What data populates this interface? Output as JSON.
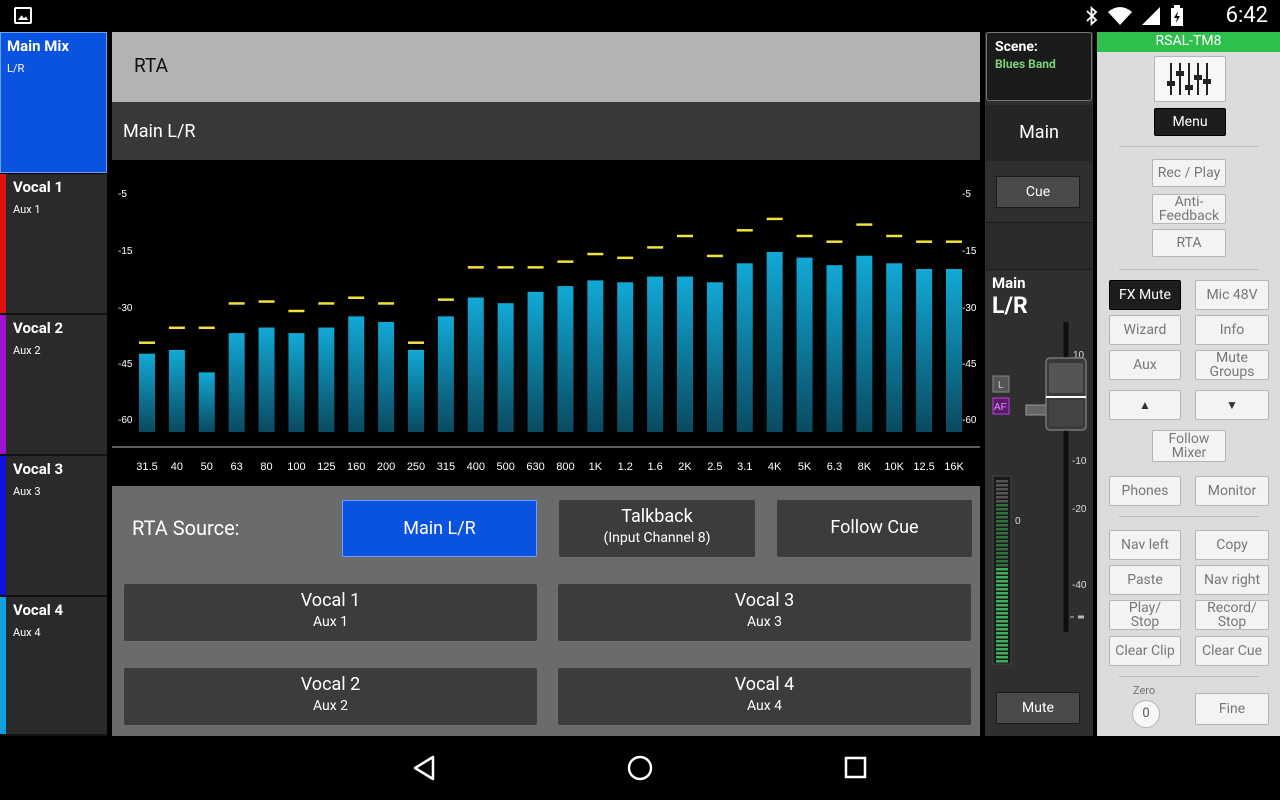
{
  "status_bar": {
    "time": "6:42",
    "icons": [
      "image-icon",
      "bluetooth-icon",
      "wifi-icon",
      "signal-icon",
      "battery-icon"
    ]
  },
  "sidebar": {
    "items": [
      {
        "title": "Main Mix",
        "sub": "L/R",
        "active": true,
        "color": "#0a52e0"
      },
      {
        "title": "Vocal 1",
        "sub": "Aux 1",
        "color": "#e01010"
      },
      {
        "title": "Vocal 2",
        "sub": "Aux 2",
        "color": "#a010d0"
      },
      {
        "title": "Vocal 3",
        "sub": "Aux 3",
        "color": "#1010e0"
      },
      {
        "title": "Vocal 4",
        "sub": "Aux 4",
        "color": "#10a0e0"
      }
    ]
  },
  "main": {
    "header": "RTA",
    "subheader": "Main L/R"
  },
  "chart_data": {
    "type": "bar",
    "categories": [
      "31.5",
      "40",
      "50",
      "63",
      "80",
      "100",
      "125",
      "160",
      "200",
      "250",
      "315",
      "400",
      "500",
      "630",
      "800",
      "1K",
      "1.2",
      "1.6",
      "2K",
      "2.5",
      "3.1",
      "4K",
      "5K",
      "6.3",
      "8K",
      "10K",
      "12.5",
      "16K"
    ],
    "values": [
      -42.5,
      -41.5,
      -47.5,
      -37,
      -35.5,
      -37,
      -35.5,
      -32.5,
      -34,
      -41.5,
      -32.5,
      -27.5,
      -29,
      -26,
      -24.5,
      -23,
      -23.5,
      -22,
      -22,
      -23.5,
      -18.5,
      -15.5,
      -17,
      -19,
      -16.5,
      -18.5,
      -20,
      -20
    ],
    "peaks": [
      -39.5,
      -35.5,
      -35.5,
      -29,
      -28.5,
      -31,
      -29,
      -27.5,
      -29,
      -39.5,
      -28,
      -19.5,
      -19.5,
      -19.5,
      -18,
      -16,
      -17,
      -14.5,
      -12.5,
      -16.5,
      -11.5,
      -9.5,
      -12.5,
      -13.5,
      -10.5,
      -12.5,
      -13.5,
      -13.5
    ],
    "yticks": [
      "-5",
      "-15",
      "-30",
      "-45",
      "-60"
    ],
    "ylim": [
      -65,
      -5
    ],
    "bar_color": "#12a9d6",
    "peak_color": "#f2e13a"
  },
  "source": {
    "label": "RTA Source:",
    "buttons": {
      "main_lr": "Main L/R",
      "talkback_l1": "Talkback",
      "talkback_l2": "(Input Channel 8)",
      "follow_cue": "Follow Cue",
      "vocal1_l1": "Vocal 1",
      "vocal1_l2": "Aux 1",
      "vocal3_l1": "Vocal 3",
      "vocal3_l2": "Aux 3",
      "vocal2_l1": "Vocal 2",
      "vocal2_l2": "Aux 2",
      "vocal4_l1": "Vocal 4",
      "vocal4_l2": "Aux 4"
    }
  },
  "fader": {
    "scene_label": "Scene:",
    "scene_name": "Blues Band",
    "title": "Main",
    "cue": "Cue",
    "label1": "Main",
    "label2": "L/R",
    "l_badge": "L",
    "af_badge": "AF",
    "meter_zero": "0",
    "scale": [
      "10",
      "0",
      "-10",
      "-20",
      "-40"
    ],
    "mute": "Mute"
  },
  "right_panel": {
    "device": "RSAL-TM8",
    "menu": "Menu",
    "rec_play": "Rec / Play",
    "anti_feedback_1": "Anti-",
    "anti_feedback_2": "Feedback",
    "rta": "RTA",
    "fx_mute": "FX Mute",
    "mic_48v": "Mic 48V",
    "wizard": "Wizard",
    "info": "Info",
    "aux": "Aux",
    "mute_groups_1": "Mute",
    "mute_groups_2": "Groups",
    "up": "▲",
    "down": "▼",
    "follow_mixer_1": "Follow",
    "follow_mixer_2": "Mixer",
    "phones": "Phones",
    "monitor": "Monitor",
    "nav_left": "Nav left",
    "copy": "Copy",
    "paste": "Paste",
    "nav_right": "Nav right",
    "play_stop_1": "Play/",
    "play_stop_2": "Stop",
    "record_stop_1": "Record/",
    "record_stop_2": "Stop",
    "clear_clip": "Clear Clip",
    "clear_cue": "Clear Cue",
    "zero_label": "Zero",
    "zero_value": "0",
    "fine": "Fine"
  }
}
